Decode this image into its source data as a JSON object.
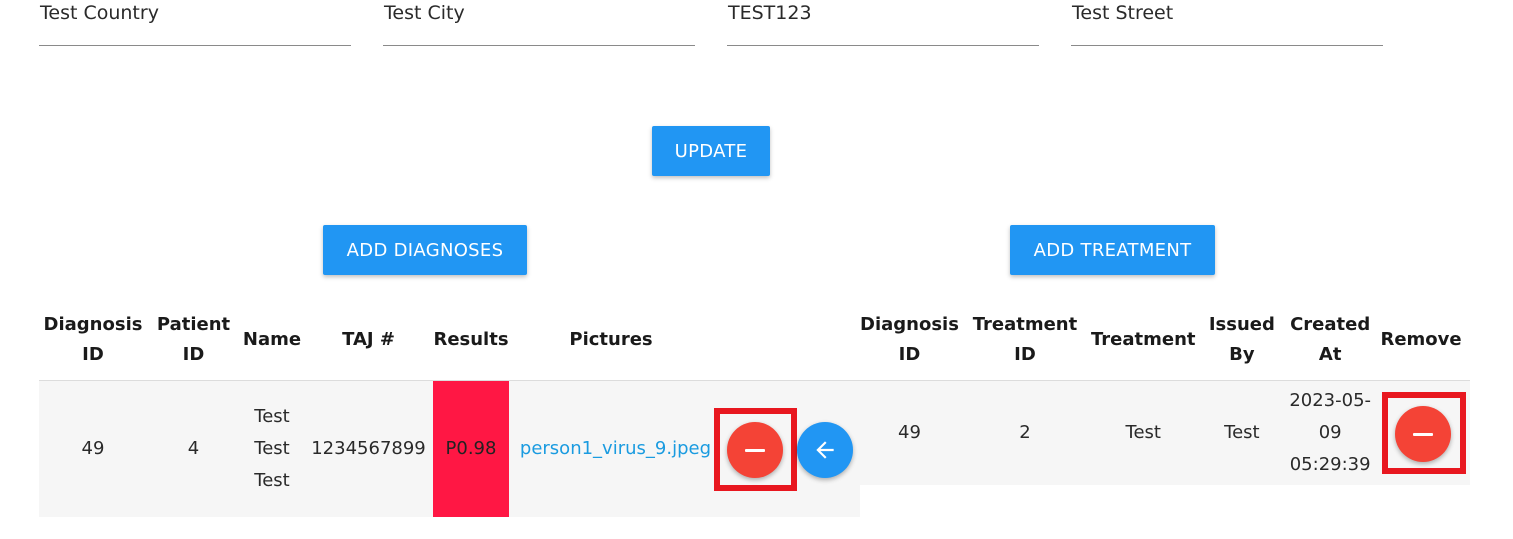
{
  "fields": {
    "country": "Test Country",
    "city": "Test City",
    "zip": "TEST123",
    "street": "Test Street"
  },
  "buttons": {
    "update": "UPDATE",
    "add_diagnoses": "ADD DIAGNOSES",
    "add_treatment": "ADD TREATMENT"
  },
  "diagnoses_table": {
    "headers": {
      "diagnosis_id_1": "Diagnosis",
      "diagnosis_id_2": "ID",
      "patient_id_1": "Patient",
      "patient_id_2": "ID",
      "name": "Name",
      "taj": "TAJ #",
      "results": "Results",
      "pictures": "Pictures"
    },
    "rows": [
      {
        "diagnosis_id": "49",
        "patient_id": "4",
        "name_line1": "Test",
        "name_line2": "Test",
        "name_line3": "Test",
        "taj": "1234567899",
        "results": "P0.98",
        "picture": "person1_virus_9.jpeg"
      }
    ]
  },
  "treatment_table": {
    "headers": {
      "diagnosis_id_1": "Diagnosis",
      "diagnosis_id_2": "ID",
      "treatment_id_1": "Treatment",
      "treatment_id_2": "ID",
      "treatment": "Treatment",
      "issued_by_1": "Issued",
      "issued_by_2": "By",
      "created_at": "Created At",
      "remove": "Remove"
    },
    "rows": [
      {
        "diagnosis_id": "49",
        "treatment_id": "2",
        "treatment": "Test",
        "issued_by": "Test",
        "created_date": "2023-05-09",
        "created_time": "05:29:39"
      }
    ]
  },
  "icons": {
    "remove": "minus-circle-icon",
    "back": "arrow-left-icon"
  },
  "colors": {
    "primary": "#2196f3",
    "danger": "#f44336",
    "results_highlight": "#ff1744",
    "annotation_box": "#e8171f"
  }
}
